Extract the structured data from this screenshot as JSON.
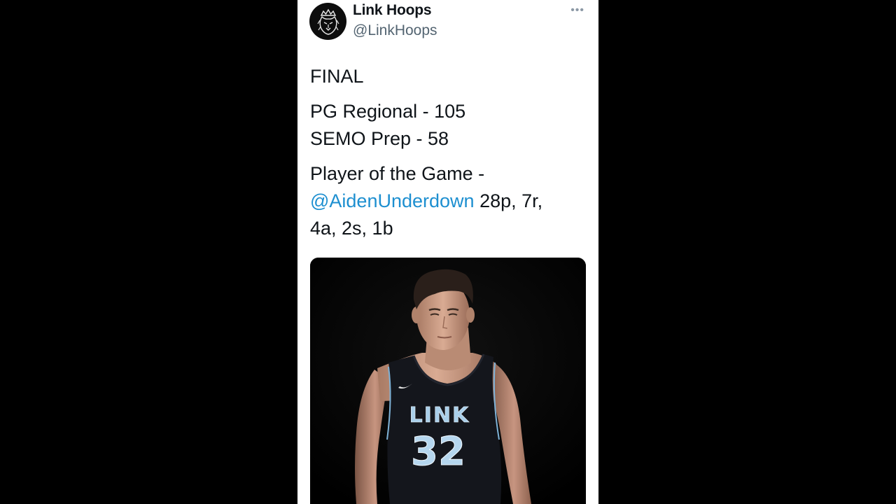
{
  "tweet": {
    "display_name": "Link Hoops",
    "handle": "@LinkHoops",
    "more_icon": "more-horizontal-icon",
    "status": "FINAL",
    "team1_line": "PG Regional - 105",
    "team2_line": "SEMO Prep - 58",
    "potg_label": "Player of the Game -",
    "mention": "@AidenUnderdown",
    "stats_inline": " 28p, 7r,",
    "stats_line2": "4a, 2s, 1b"
  },
  "media": {
    "jersey_text": "LINK",
    "jersey_number": "32"
  },
  "colors": {
    "background": "#000000",
    "card": "#ffffff",
    "mention": "#1d8fd0",
    "secondary_text": "#536471"
  }
}
